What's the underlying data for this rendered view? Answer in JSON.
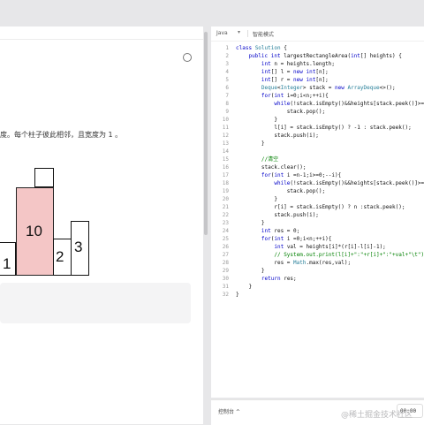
{
  "problem": {
    "description": "度。每个柱子彼此相邻，且宽度为 1 。",
    "bars": [
      {
        "label": "1"
      },
      {
        "label": "10"
      },
      {
        "label": "2"
      },
      {
        "label": "3"
      }
    ]
  },
  "editor": {
    "language": "Java",
    "mode_label": "智能模式",
    "code": [
      {
        "n": "1",
        "t": [
          [
            "kw",
            "class "
          ],
          [
            "ty",
            "Solution"
          ],
          [
            "pl",
            " {"
          ]
        ]
      },
      {
        "n": "2",
        "t": [
          [
            "pl",
            "    "
          ],
          [
            "kw",
            "public int "
          ],
          [
            "pl",
            "largestRectangleArea("
          ],
          [
            "kw",
            "int"
          ],
          [
            "pl",
            "[] heights) {"
          ]
        ]
      },
      {
        "n": "3",
        "t": [
          [
            "pl",
            "        "
          ],
          [
            "kw",
            "int "
          ],
          [
            "pl",
            "n = heights.length;"
          ]
        ]
      },
      {
        "n": "4",
        "t": [
          [
            "pl",
            "        "
          ],
          [
            "kw",
            "int"
          ],
          [
            "pl",
            "[] l = "
          ],
          [
            "kw",
            "new int"
          ],
          [
            "pl",
            "[n];"
          ]
        ]
      },
      {
        "n": "5",
        "t": [
          [
            "pl",
            "        "
          ],
          [
            "kw",
            "int"
          ],
          [
            "pl",
            "[] r = "
          ],
          [
            "kw",
            "new int"
          ],
          [
            "pl",
            "[n];"
          ]
        ]
      },
      {
        "n": "6",
        "t": [
          [
            "pl",
            "        "
          ],
          [
            "ty",
            "Deque"
          ],
          [
            "pl",
            "<"
          ],
          [
            "ty",
            "Integer"
          ],
          [
            "pl",
            "> stack = "
          ],
          [
            "kw",
            "new "
          ],
          [
            "ty",
            "ArrayDeque"
          ],
          [
            "pl",
            "<>();"
          ]
        ]
      },
      {
        "n": "7",
        "t": [
          [
            "pl",
            "        "
          ],
          [
            "kw",
            "for"
          ],
          [
            "pl",
            "("
          ],
          [
            "kw",
            "int "
          ],
          [
            "pl",
            "i=0;i<n;++i){"
          ]
        ]
      },
      {
        "n": "8",
        "t": [
          [
            "pl",
            "            "
          ],
          [
            "kw",
            "while"
          ],
          [
            "pl",
            "(!stack.isEmpty()&&heights[stack.peek()]>=heights[i]){"
          ]
        ]
      },
      {
        "n": "9",
        "t": [
          [
            "pl",
            "                stack.pop();"
          ]
        ]
      },
      {
        "n": "10",
        "t": [
          [
            "pl",
            "            }"
          ]
        ]
      },
      {
        "n": "11",
        "t": [
          [
            "pl",
            "            l[i] = stack.isEmpty() ? -1 : stack.peek();"
          ]
        ]
      },
      {
        "n": "12",
        "t": [
          [
            "pl",
            "            stack.push(i);"
          ]
        ]
      },
      {
        "n": "13",
        "t": [
          [
            "pl",
            "        }"
          ]
        ]
      },
      {
        "n": "14",
        "t": []
      },
      {
        "n": "15",
        "t": [
          [
            "pl",
            "        "
          ],
          [
            "cm",
            "//清空"
          ]
        ]
      },
      {
        "n": "16",
        "t": [
          [
            "pl",
            "        stack.clear();"
          ]
        ]
      },
      {
        "n": "17",
        "t": [
          [
            "pl",
            "        "
          ],
          [
            "kw",
            "for"
          ],
          [
            "pl",
            "("
          ],
          [
            "kw",
            "int "
          ],
          [
            "pl",
            "i =n-1;i>=0;--i){"
          ]
        ]
      },
      {
        "n": "18",
        "t": [
          [
            "pl",
            "            "
          ],
          [
            "kw",
            "while"
          ],
          [
            "pl",
            "(!stack.isEmpty()&&heights[stack.peek()]>=heights[i]){"
          ]
        ]
      },
      {
        "n": "19",
        "t": [
          [
            "pl",
            "                stack.pop();"
          ]
        ]
      },
      {
        "n": "20",
        "t": [
          [
            "pl",
            "            }"
          ]
        ]
      },
      {
        "n": "21",
        "t": [
          [
            "pl",
            "            r[i] = stack.isEmpty() ? n :stack.peek();"
          ]
        ]
      },
      {
        "n": "22",
        "t": [
          [
            "pl",
            "            stack.push(i);"
          ]
        ]
      },
      {
        "n": "23",
        "t": [
          [
            "pl",
            "        }"
          ]
        ]
      },
      {
        "n": "24",
        "t": [
          [
            "pl",
            "        "
          ],
          [
            "kw",
            "int "
          ],
          [
            "pl",
            "res = 0;"
          ]
        ]
      },
      {
        "n": "25",
        "t": [
          [
            "pl",
            "        "
          ],
          [
            "kw",
            "for"
          ],
          [
            "pl",
            "("
          ],
          [
            "kw",
            "int "
          ],
          [
            "pl",
            "i =0;i<n;++i){"
          ]
        ]
      },
      {
        "n": "26",
        "t": [
          [
            "pl",
            "            "
          ],
          [
            "kw",
            "int "
          ],
          [
            "pl",
            "val = heights[i]*(r[i]-l[i]-1);"
          ]
        ]
      },
      {
        "n": "27",
        "t": [
          [
            "pl",
            "            "
          ],
          [
            "cm",
            "// System.out.print(l[i]+\":\"+r[i]+\":\"+val+\"\\t\");"
          ]
        ]
      },
      {
        "n": "28",
        "t": [
          [
            "pl",
            "            res = "
          ],
          [
            "ty",
            "Math"
          ],
          [
            "pl",
            ".max(res,val);"
          ]
        ]
      },
      {
        "n": "29",
        "t": [
          [
            "pl",
            "        }"
          ]
        ]
      },
      {
        "n": "30",
        "t": [
          [
            "pl",
            "        "
          ],
          [
            "kw",
            "return "
          ],
          [
            "pl",
            "res;"
          ]
        ]
      },
      {
        "n": "31",
        "t": [
          [
            "pl",
            "    }"
          ]
        ]
      },
      {
        "n": "32",
        "t": [
          [
            "pl",
            "}"
          ]
        ]
      }
    ]
  },
  "bottom": {
    "console_label": "控制台 ^",
    "timer": "00:00"
  },
  "watermark": "@稀土掘金技术社区"
}
